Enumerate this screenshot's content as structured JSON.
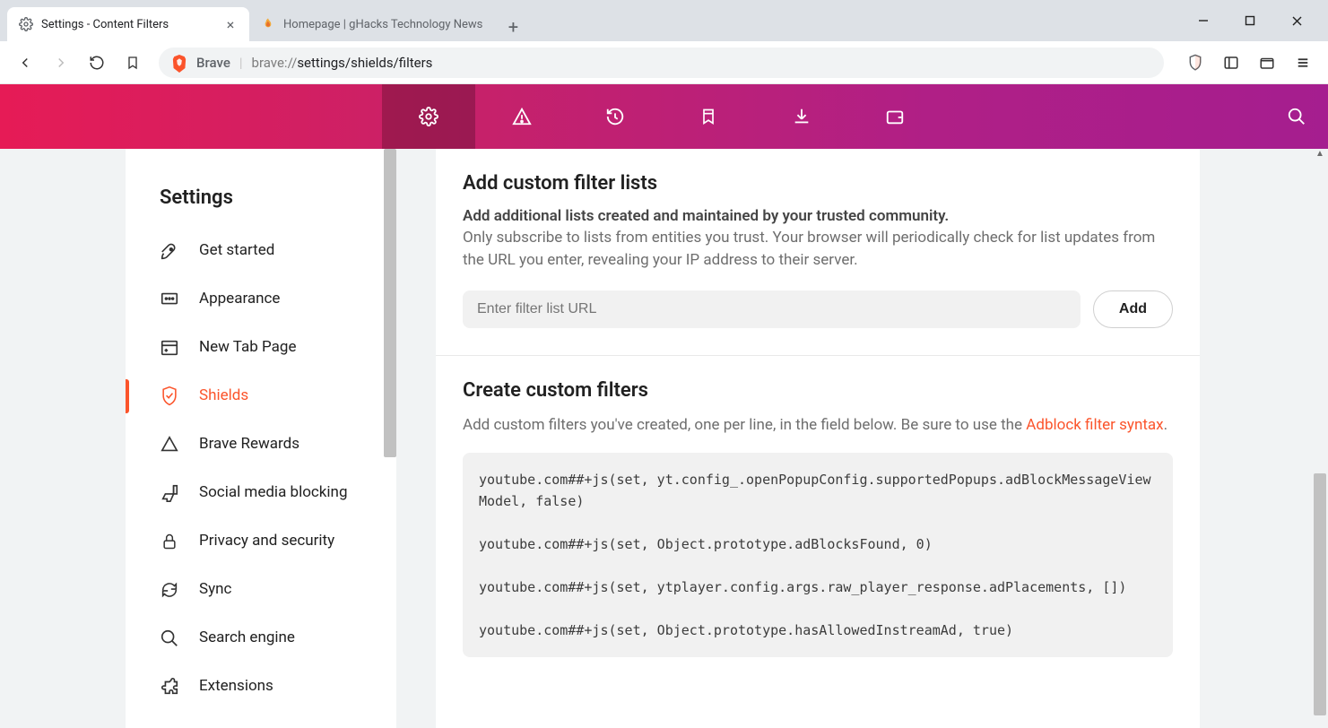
{
  "tabs": [
    {
      "title": "Settings - Content Filters",
      "favicon": "gear",
      "active": true
    },
    {
      "title": "Homepage | gHacks Technology News",
      "favicon": "flame",
      "active": false
    }
  ],
  "window": {
    "minimize": "min",
    "maximize": "max",
    "close": "close"
  },
  "addressBar": {
    "brandLabel": "Brave",
    "urlScheme": "brave://",
    "urlPath": "settings/shields/filters"
  },
  "brandTabs": [
    "gear",
    "warning",
    "history",
    "bookmark",
    "download",
    "wallet"
  ],
  "sidebar": {
    "heading": "Settings",
    "items": [
      {
        "label": "Get started",
        "icon": "rocket"
      },
      {
        "label": "Appearance",
        "icon": "appearance"
      },
      {
        "label": "New Tab Page",
        "icon": "newtab"
      },
      {
        "label": "Shields",
        "icon": "shield",
        "active": true
      },
      {
        "label": "Brave Rewards",
        "icon": "rewards"
      },
      {
        "label": "Social media blocking",
        "icon": "social"
      },
      {
        "label": "Privacy and security",
        "icon": "lock"
      },
      {
        "label": "Sync",
        "icon": "sync"
      },
      {
        "label": "Search engine",
        "icon": "search"
      },
      {
        "label": "Extensions",
        "icon": "puzzle"
      }
    ]
  },
  "main": {
    "section1": {
      "title": "Add custom filter lists",
      "lead": "Add additional lists created and maintained by your trusted community.",
      "para": "Only subscribe to lists from entities you trust. Your browser will periodically check for list updates from the URL you enter, revealing your IP address to their server.",
      "inputPlaceholder": "Enter filter list URL",
      "addButton": "Add"
    },
    "section2": {
      "title": "Create custom filters",
      "paraPrefix": "Add custom filters you've created, one per line, in the field below. Be sure to use the ",
      "linkText": "Adblock filter syntax",
      "paraSuffix": ".",
      "code": "youtube.com##+js(set, yt.config_.openPopupConfig.supportedPopups.adBlockMessageViewModel, false)\n\nyoutube.com##+js(set, Object.prototype.adBlocksFound, 0)\n\nyoutube.com##+js(set, ytplayer.config.args.raw_player_response.adPlacements, [])\n\nyoutube.com##+js(set, Object.prototype.hasAllowedInstreamAd, true)"
    }
  }
}
